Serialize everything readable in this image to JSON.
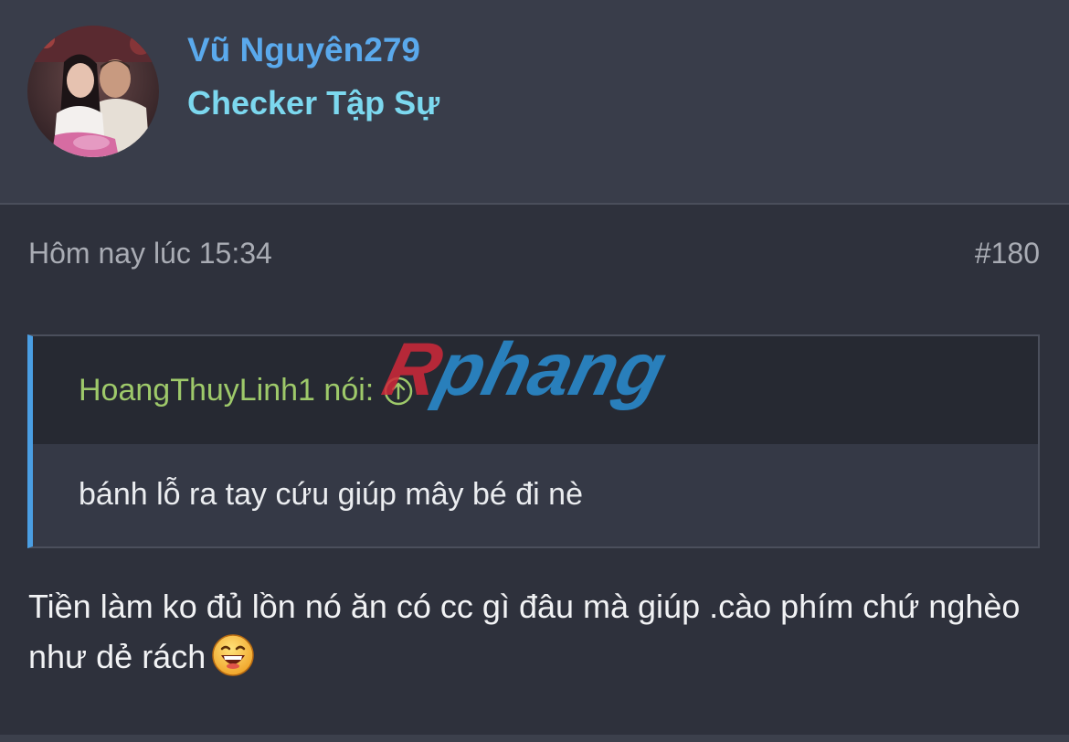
{
  "user": {
    "name": "Vũ Nguyên279",
    "title": "Checker Tập Sự"
  },
  "post": {
    "timestamp": "Hôm nay lúc 15:34",
    "number": "#180",
    "quote": {
      "author_line": "HoangThuyLinh1 nói:",
      "arrow_icon": "arrow-up-circle-icon",
      "text": "bánh lỗ ra tay cứu giúp mây bé đi nè"
    },
    "message": "Tiền làm ko đủ lồn nó ăn có cc gì đâu mà giúp .cào phím chứ nghèo như dẻ rách",
    "emoji": "laughing-emoji-icon"
  },
  "watermark": {
    "text": "Rphang"
  },
  "colors": {
    "username": "#5aa9ec",
    "user_title": "#7cd8ef",
    "quote_author": "#9ec96a",
    "quote_border": "#4a9ee3",
    "watermark_red": "#d0283a",
    "watermark_blue": "#2a8fd4"
  }
}
